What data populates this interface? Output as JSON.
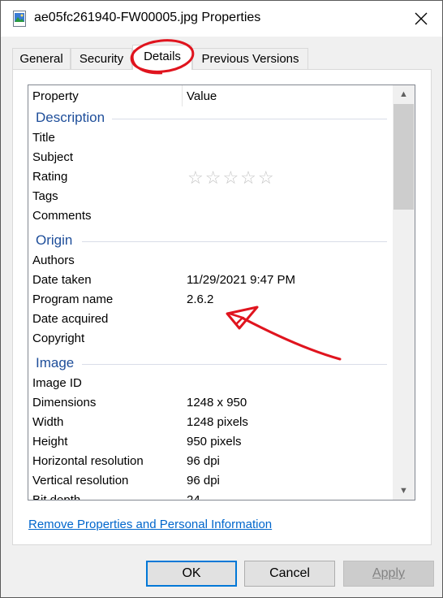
{
  "window": {
    "title": "ae05fc261940-FW00005.jpg Properties"
  },
  "tabs": [
    {
      "label": "General"
    },
    {
      "label": "Security"
    },
    {
      "label": "Details"
    },
    {
      "label": "Previous Versions"
    }
  ],
  "details": {
    "columns": {
      "property": "Property",
      "value": "Value"
    },
    "groups": {
      "description": "Description",
      "origin": "Origin",
      "image": "Image"
    },
    "rows": {
      "title": {
        "name": "Title",
        "value": ""
      },
      "subject": {
        "name": "Subject",
        "value": ""
      },
      "rating": {
        "name": "Rating",
        "value": "☆☆☆☆☆"
      },
      "tags": {
        "name": "Tags",
        "value": ""
      },
      "comments": {
        "name": "Comments",
        "value": ""
      },
      "authors": {
        "name": "Authors",
        "value": ""
      },
      "date_taken": {
        "name": "Date taken",
        "value": "11/29/2021 9:47 PM"
      },
      "program_name": {
        "name": "Program name",
        "value": "2.6.2"
      },
      "date_acquired": {
        "name": "Date acquired",
        "value": ""
      },
      "copyright": {
        "name": "Copyright",
        "value": ""
      },
      "image_id": {
        "name": "Image ID",
        "value": ""
      },
      "dimensions": {
        "name": "Dimensions",
        "value": "1248 x 950"
      },
      "width": {
        "name": "Width",
        "value": "1248 pixels"
      },
      "height": {
        "name": "Height",
        "value": "950 pixels"
      },
      "horizontal_resolution": {
        "name": "Horizontal resolution",
        "value": "96 dpi"
      },
      "vertical_resolution": {
        "name": "Vertical resolution",
        "value": "96 dpi"
      },
      "bit_depth": {
        "name": "Bit depth",
        "value": "24"
      }
    },
    "scrollbar": {
      "up_icon": "▲",
      "down_icon": "▼"
    }
  },
  "remove_link": "Remove Properties and Personal Information",
  "buttons": {
    "ok": "OK",
    "cancel": "Cancel",
    "apply": "Apply"
  },
  "colors": {
    "accent": "#0078d7",
    "group_title": "#1e4e9a",
    "link": "#0066cc",
    "annotation_red": "#e0141e"
  }
}
